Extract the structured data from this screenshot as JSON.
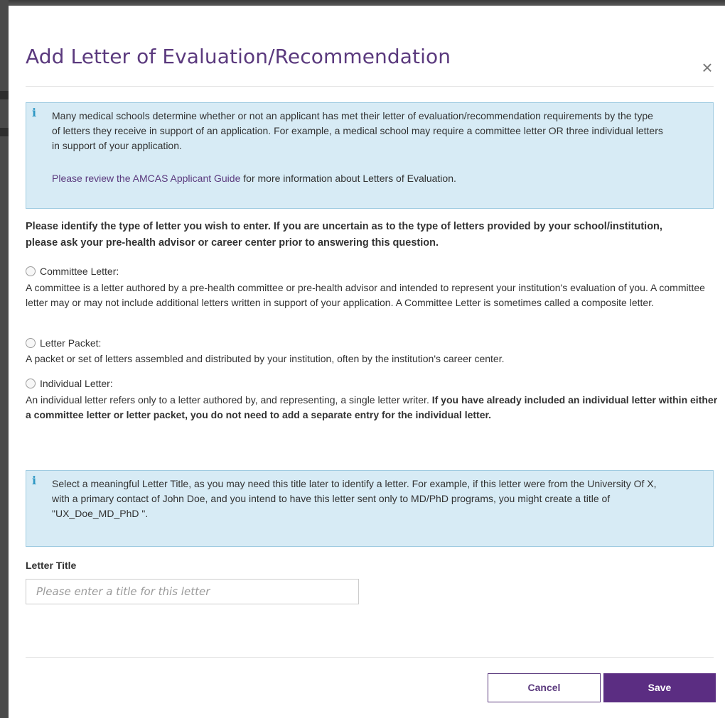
{
  "dialog": {
    "title": "Add Letter of Evaluation/Recommendation",
    "close_icon": "close-icon",
    "close_glyph": "×"
  },
  "info_alert": {
    "icon": "info-icon",
    "icon_glyph": "i",
    "text": "Many medical schools determine whether or not an applicant has met their letter of evaluation/recommendation requirements by the type of letters they receive in support of an application. For example, a medical school may require a committee letter OR three individual letters in support of your application.",
    "link_text": "Please review the AMCAS Applicant Guide",
    "link_suffix": " for more information about Letters of Evaluation."
  },
  "letter_type": {
    "question": "Please identify the type of letter you wish to enter. If you are uncertain as to the type of letters provided by your school/institution, please ask your pre-health advisor or career center prior to answering this question.",
    "options": [
      {
        "label": "Committee Letter:",
        "description": "A committee is a letter authored by a pre-health committee or pre-health advisor and intended to represent your institution's evaluation of you. A committee letter may or may not include additional letters written in support of your application. A Committee Letter is sometimes called a composite letter.",
        "selected": false
      },
      {
        "label": "Letter Packet:",
        "description": "A packet or set of letters assembled and distributed by your institution, often by the institution's career center.",
        "selected": false
      },
      {
        "label": "Individual Letter:",
        "description": "An individual letter refers only to a letter authored by, and representing, a single letter writer. ",
        "description_bold": "If you have already included an individual letter within either a committee letter or letter packet, you do not need to add a separate entry for the individual letter.",
        "selected": false
      }
    ]
  },
  "title_alert": {
    "icon": "info-icon",
    "icon_glyph": "i",
    "text": "Select a meaningful Letter Title, as you may need this title later to identify a letter. For example, if this letter were from the University Of X, with a primary contact of John Doe, and you intend to have this letter sent only to MD/PhD programs, you might create a title of \"UX_Doe_MD_PhD \"."
  },
  "letter_title": {
    "label": "Letter Title",
    "value": "",
    "placeholder": "Please enter a title for this letter"
  },
  "footer": {
    "cancel_label": "Cancel",
    "save_label": "Save"
  },
  "colors": {
    "brand_purple": "#5b2d82",
    "title_purple": "#5b3a7e",
    "alert_background": "#d7ebf5",
    "alert_border": "#9fcbe1",
    "info_icon": "#2d97c4"
  }
}
